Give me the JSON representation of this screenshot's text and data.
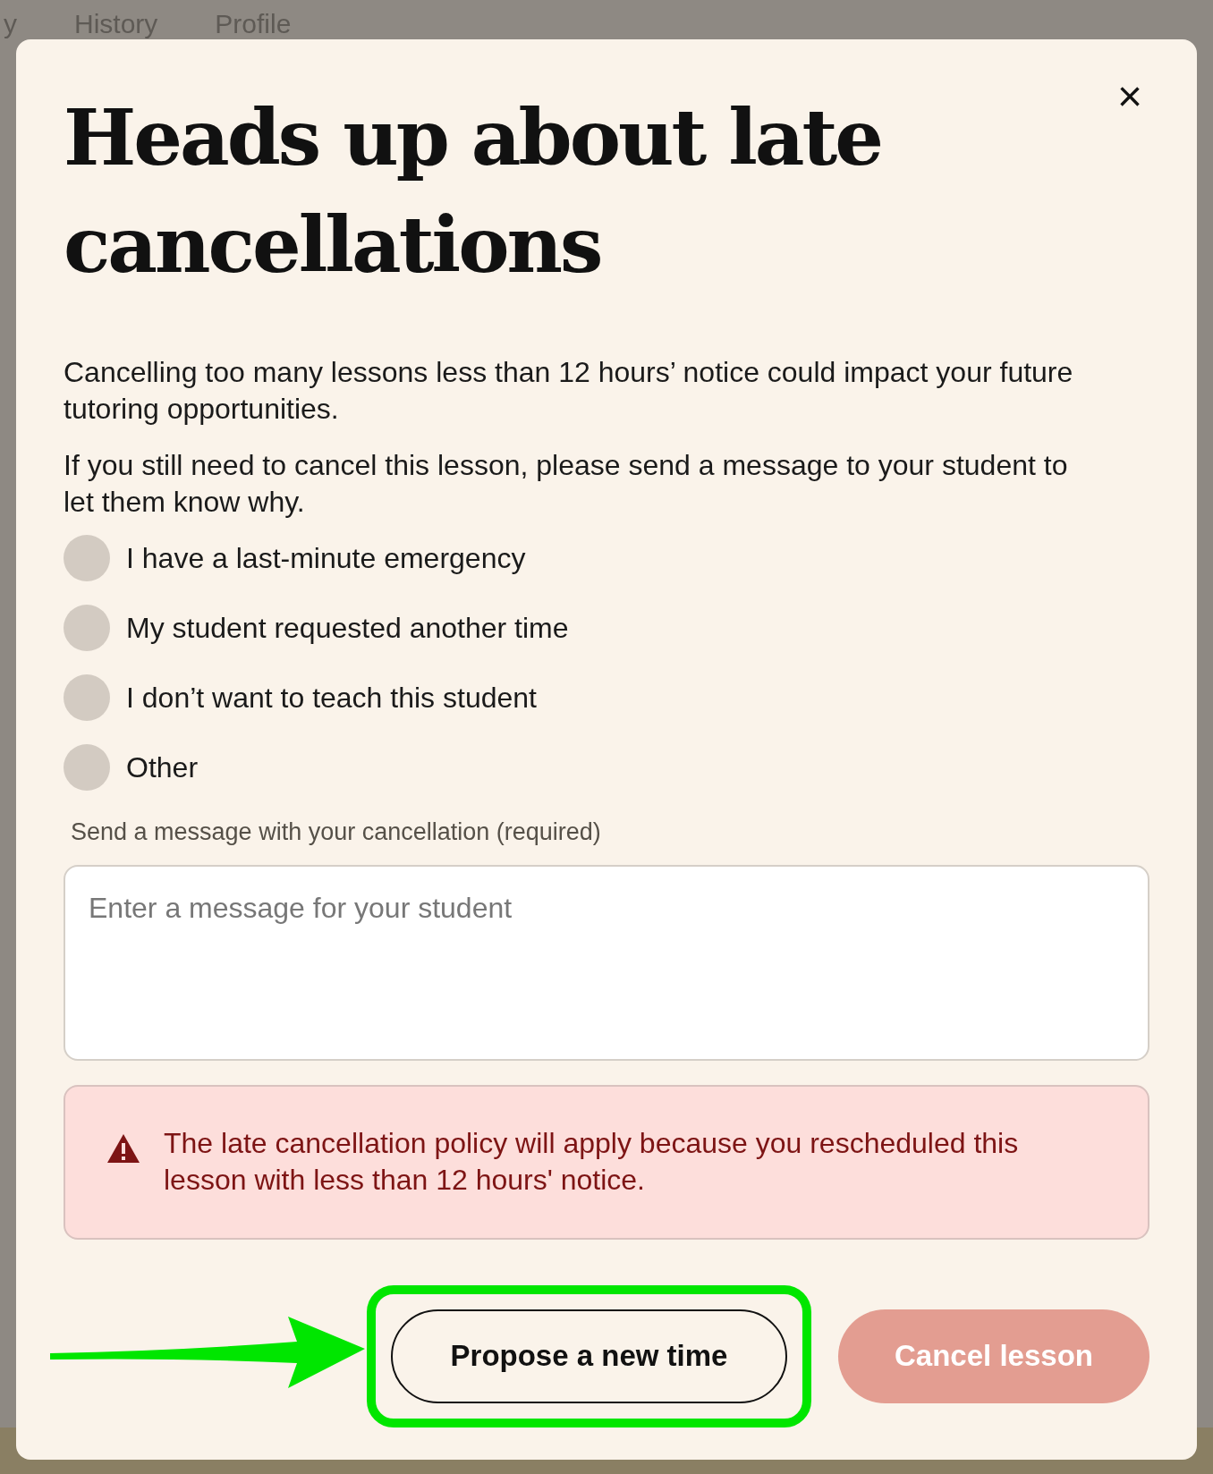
{
  "background": {
    "tabs": [
      {
        "label": "y"
      },
      {
        "label": "History"
      },
      {
        "label": "Profile"
      }
    ]
  },
  "dialog": {
    "title": "Heads up about late cancellations",
    "close": "×",
    "paragraphs": [
      "Cancelling too many lessons less than 12 hours’ notice could impact your future tutoring opportunities.",
      "If you still need to cancel this lesson, please send a message to your student to let them know why."
    ],
    "reasons": [
      {
        "label": "I have a last-minute emergency",
        "selected": false
      },
      {
        "label": "My student requested another time",
        "selected": false
      },
      {
        "label": "I don’t want to teach this student",
        "selected": false
      },
      {
        "label": "Other",
        "selected": false
      }
    ],
    "message": {
      "label": "Send a message with your cancellation (required)",
      "placeholder": "Enter a message for your student"
    },
    "warning": "The late cancellation policy will apply because you rescheduled this lesson with less than 12 hours' notice.",
    "buttons": [
      {
        "label": "Propose a new time",
        "kind": "outline",
        "highlighted": true,
        "disabled": false
      },
      {
        "label": "Cancel lesson",
        "kind": "primary",
        "highlighted": false,
        "disabled": true
      }
    ]
  }
}
